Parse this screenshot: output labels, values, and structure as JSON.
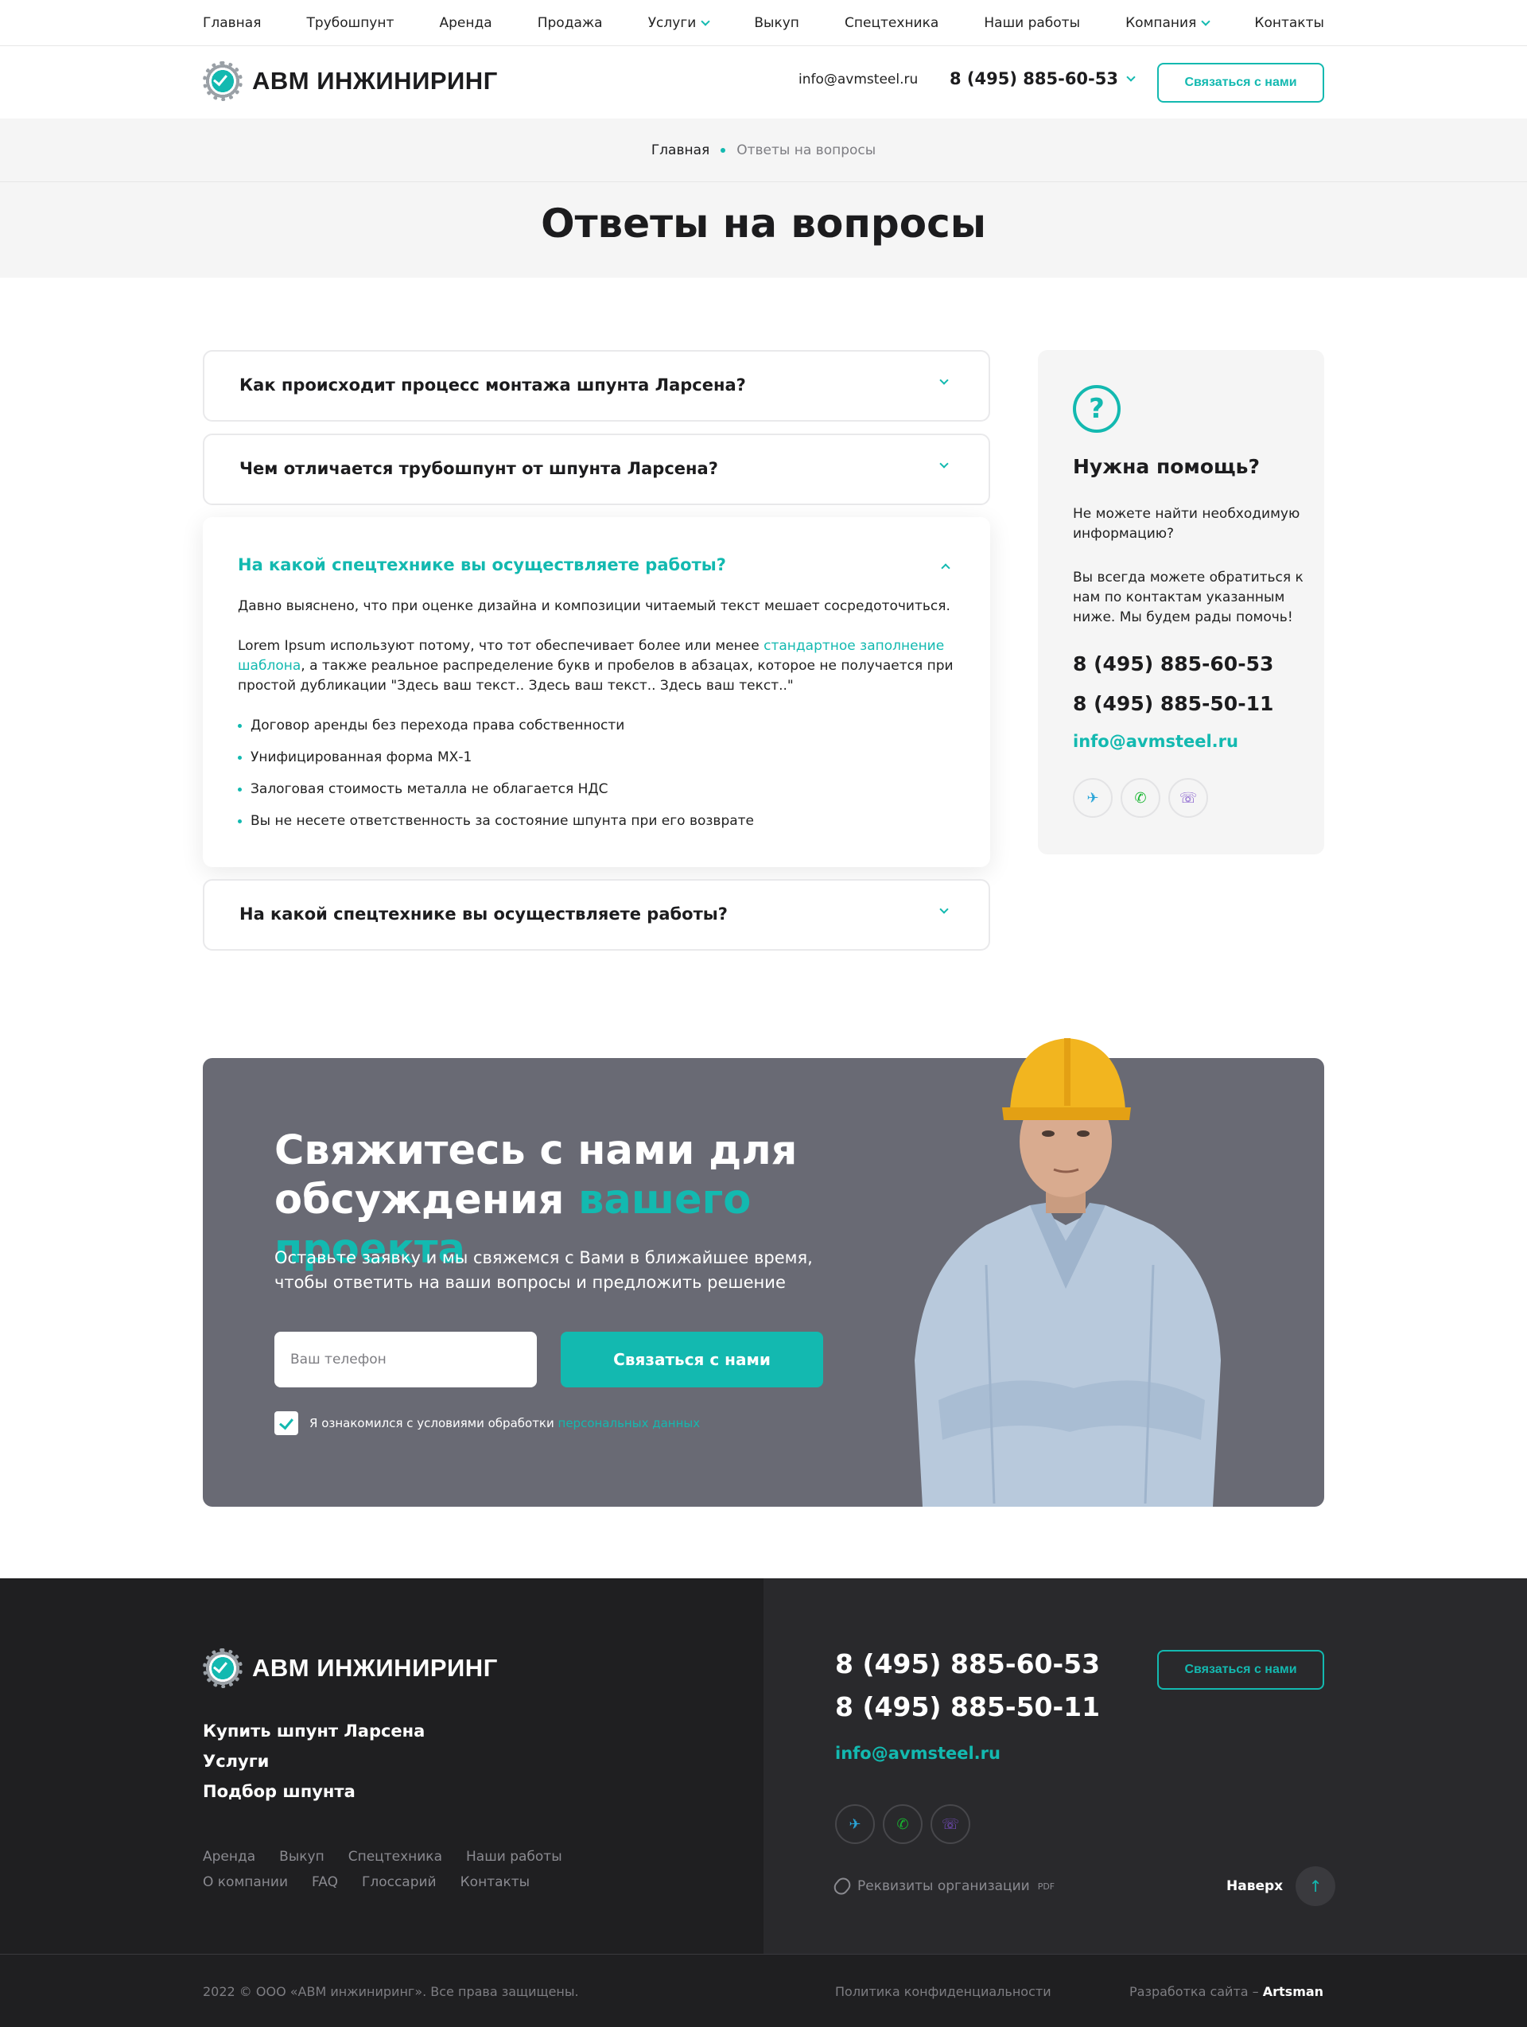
{
  "topnav": {
    "items": [
      {
        "label": "Главная"
      },
      {
        "label": "Трубошпунт"
      },
      {
        "label": "Аренда"
      },
      {
        "label": "Продажа"
      },
      {
        "label": "Услуги"
      },
      {
        "label": "Выкуп"
      },
      {
        "label": "Спецтехника"
      },
      {
        "label": "Наши работы"
      },
      {
        "label": "Компания"
      },
      {
        "label": "Контакты"
      }
    ]
  },
  "header": {
    "logo_text": "АВМ ИНЖИНИРИНГ",
    "email": "info@avmsteel.ru",
    "phone": "8 (495) 885-60-53",
    "cta_label": "Связаться с нами"
  },
  "breadcrumb": {
    "home": "Главная",
    "current": "Ответы на вопросы"
  },
  "page_title": "Ответы на вопросы",
  "faq": {
    "items": [
      {
        "question": "Как происходит процесс монтажа шпунта Ларсена?"
      },
      {
        "question": "Чем отличается трубошпунт от шпунта Ларсена?"
      },
      {
        "question": "На какой спецтехнике вы осуществляете работы?",
        "p1": "Давно выяснено, что при оценке дизайна и композиции читаемый текст мешает сосредоточиться.",
        "p2_before": "Lorem Ipsum используют потому, что тот обеспечивает более или менее ",
        "p2_link": "стандартное заполнение шаблона",
        "p2_after": ", а также реальное распределение букв и пробелов в абзацах, которое не получается при простой дубликации \"Здесь ваш текст.. Здесь ваш текст.. Здесь ваш текст..\"",
        "bullets": [
          "Договор аренды без перехода права собственности",
          "Унифицированная форма МХ-1",
          "Залоговая стоимость металла не облагается НДС",
          "Вы не несете ответственность за состояние шпунта при его возврате"
        ]
      },
      {
        "question": "На какой спецтехнике вы осуществляете работы?"
      }
    ]
  },
  "help": {
    "icon_glyph": "?",
    "title": "Нужна помощь?",
    "text1": "Не можете найти необходимую информацию?",
    "text2": "Вы всегда можете обратиться к нам по контактам указанным ниже. Мы будем рады помочь!",
    "phone1": "8 (495) 885-60-53",
    "phone2": "8 (495) 885-50-11",
    "email": "info@avmsteel.ru"
  },
  "cta": {
    "title_part1": "Свяжитесь с нами для обсуждения ",
    "title_accent": "вашего проекта",
    "subtitle": "Оставьте заявку и мы свяжемся с Вами в ближайшее время, чтобы ответить на ваши вопросы и предложить решение",
    "phone_placeholder": "Ваш телефон",
    "button_label": "Связаться с нами",
    "agree_text": "Я ознакомился с условиями обработки ",
    "agree_link": "персональных данных"
  },
  "footer": {
    "logo_text": "АВМ ИНЖИНИРИНГ",
    "menu": [
      "Купить шпунт Ларсена",
      "Услуги",
      "Подбор шпунта"
    ],
    "links": [
      "Аренда",
      "Выкуп",
      "Спецтехника",
      "Наши работы",
      "О компании",
      "FAQ",
      "Глоссарий",
      "Контакты"
    ],
    "phone1": "8 (495) 885-60-53",
    "phone2": "8 (495) 885-50-11",
    "email": "info@avmsteel.ru",
    "requisites": "Реквизиты организации",
    "requisites_badge": "PDF",
    "button_label": "Связаться с нами",
    "to_top": "Наверх",
    "copyright": "2022 © ООО «АВМ инжиниринг». Все права защищены.",
    "privacy": "Политика конфиденциальности",
    "dev_label": "Разработка сайта – ",
    "dev_name": "Artsman"
  },
  "colors": {
    "accent": "#13b9b0",
    "dark": "#1f1f21",
    "cta_bg": "#696a74"
  },
  "icons": {
    "telegram": "✈",
    "phone": "✆",
    "viber": "☏",
    "arrow_up": "↑"
  }
}
